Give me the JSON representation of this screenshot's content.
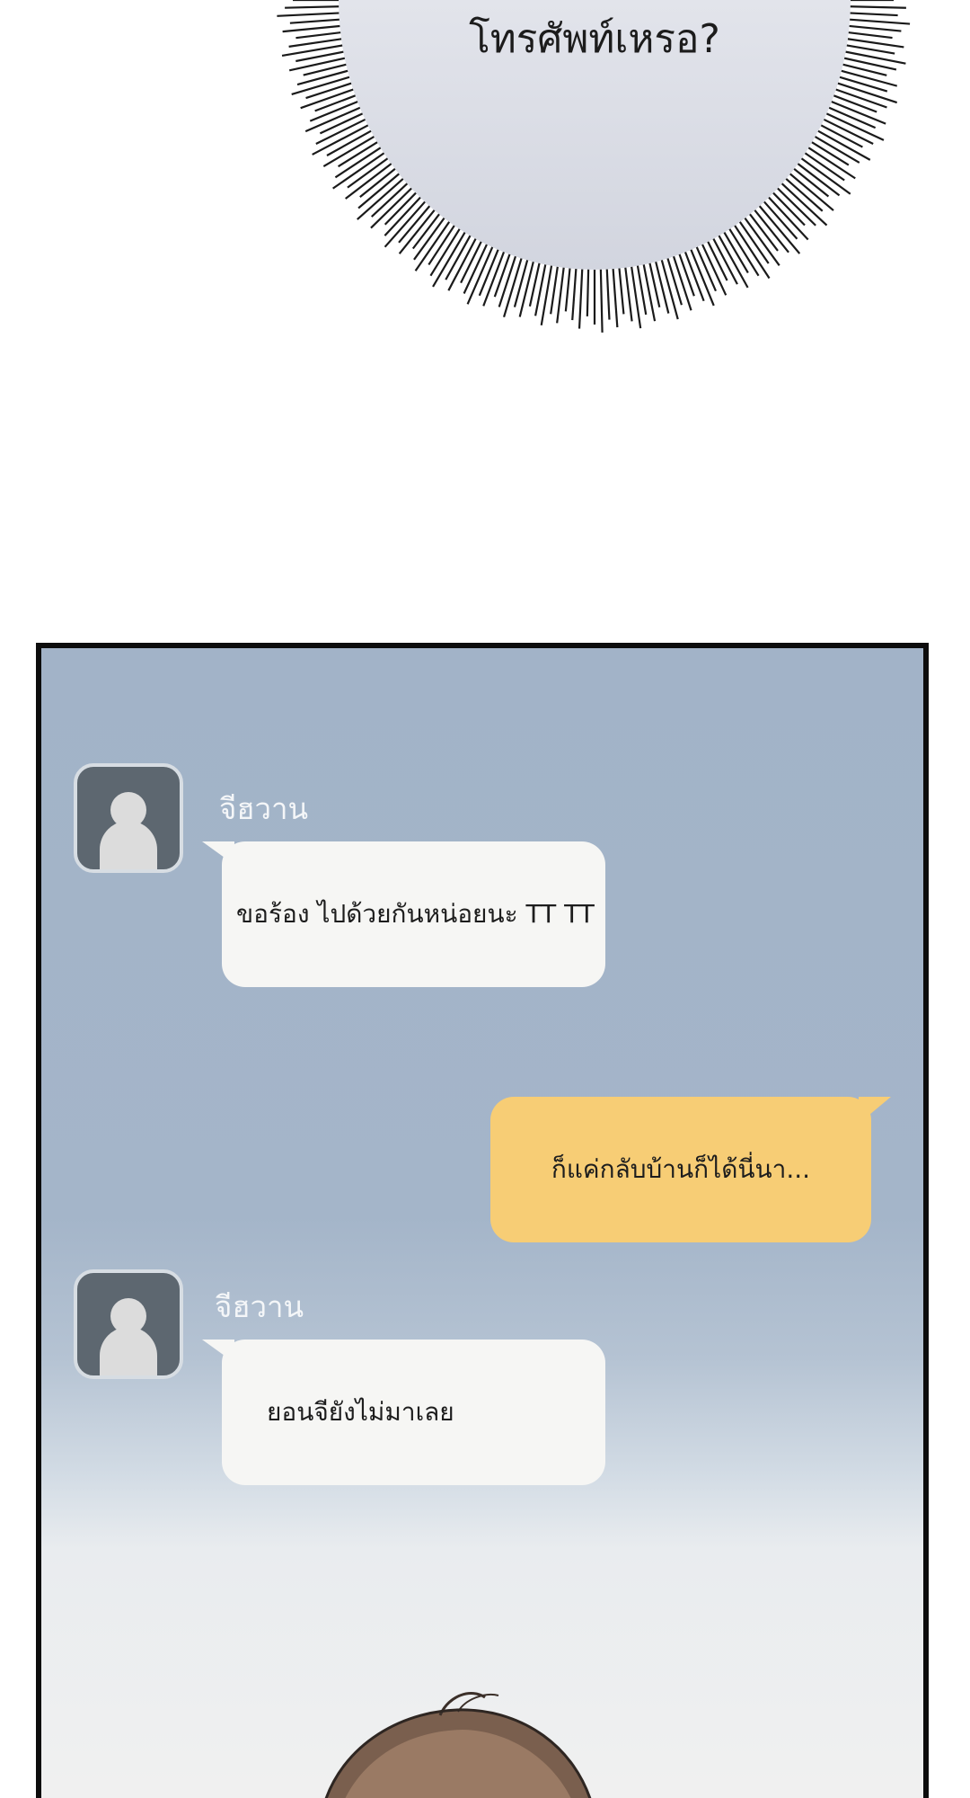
{
  "burst_bubble": {
    "text": "โทรศัพท์เหรอ?"
  },
  "chat": {
    "colors": {
      "incoming_bubble": "#f6f6f4",
      "outgoing_bubble": "#f7cd75",
      "panel_background": "#a2b3c8"
    },
    "messages": [
      {
        "sender": "จีฮวาน",
        "direction": "incoming",
        "text": "ขอร้อง ไปด้วยกันหน่อยนะ TT TT"
      },
      {
        "sender": "",
        "direction": "outgoing",
        "text": "ก็แค่กลับบ้านก็ได้นี่นา..."
      },
      {
        "sender": "จีฮวาน",
        "direction": "incoming",
        "text": "ยอนจียังไม่มาเลย"
      }
    ]
  }
}
